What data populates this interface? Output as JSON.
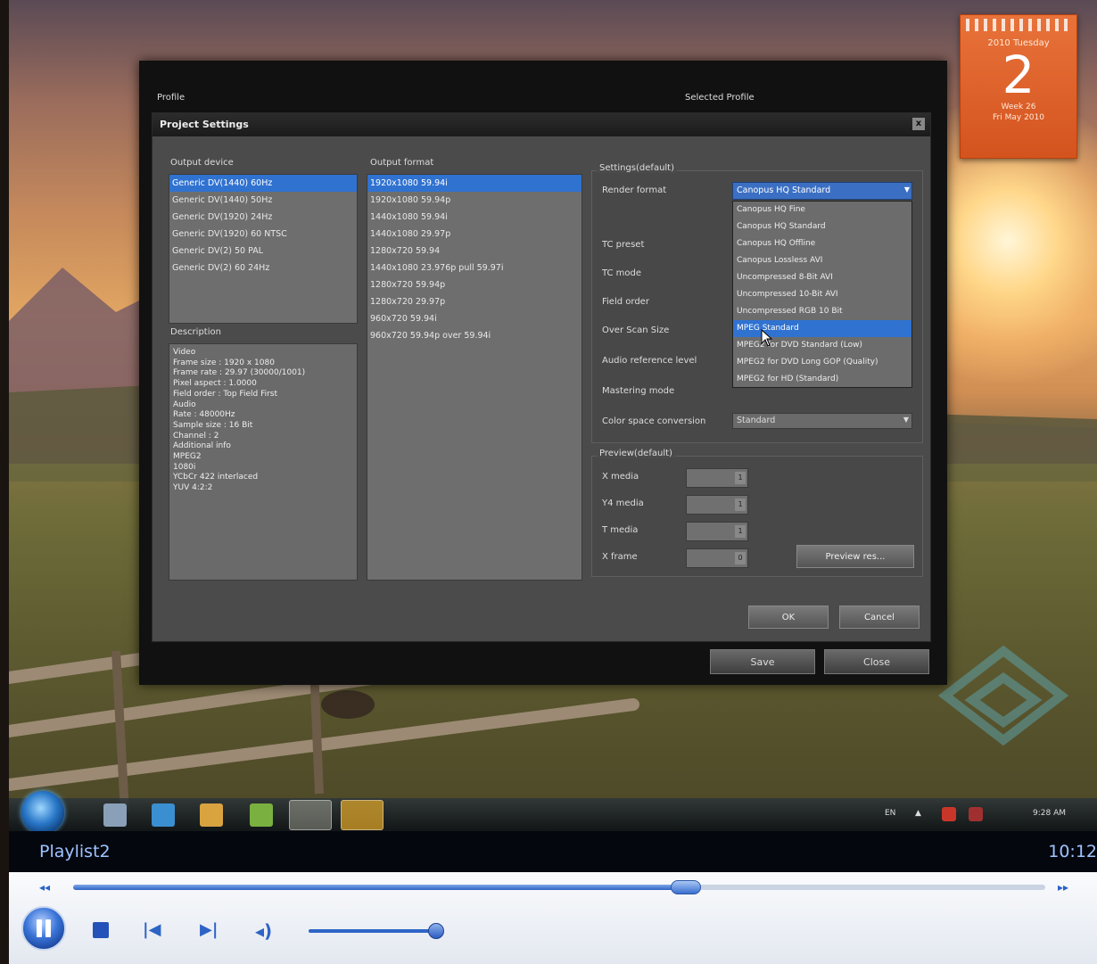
{
  "gadget": {
    "month": "2010 Tuesday",
    "day": "2",
    "week_a": "Week 26",
    "week_b": "Fri May 2010"
  },
  "outer_window": {
    "title_left": "Profile",
    "title_right": "Selected Profile",
    "save_label": "Save",
    "close_label": "Close"
  },
  "dialog": {
    "title": "Project Settings",
    "close_glyph": "x",
    "output_device_label": "Output device",
    "output_devices": [
      {
        "label": "Generic DV(1440) 60Hz",
        "selected": true
      },
      {
        "label": "Generic DV(1440) 50Hz",
        "selected": false
      },
      {
        "label": "Generic DV(1920) 24Hz",
        "selected": false
      },
      {
        "label": "Generic DV(1920) 60 NTSC",
        "selected": false
      },
      {
        "label": "Generic DV(2) 50 PAL",
        "selected": false
      },
      {
        "label": "Generic DV(2) 60 24Hz",
        "selected": false
      }
    ],
    "output_format_label": "Output format",
    "output_formats": [
      {
        "label": "1920x1080 59.94i",
        "selected": true
      },
      {
        "label": "1920x1080 59.94p",
        "selected": false
      },
      {
        "label": "1440x1080 59.94i",
        "selected": false
      },
      {
        "label": "1440x1080 29.97p",
        "selected": false
      },
      {
        "label": "1280x720 59.94",
        "selected": false
      },
      {
        "label": "1440x1080 23.976p pull 59.97i",
        "selected": false
      },
      {
        "label": "1280x720 59.94p",
        "selected": false
      },
      {
        "label": "1280x720 29.97p",
        "selected": false
      },
      {
        "label": "960x720 59.94i",
        "selected": false
      },
      {
        "label": "960x720 59.94p over 59.94i",
        "selected": false
      }
    ],
    "description_label": "Description",
    "description_lines": [
      "Video",
      "Frame size : 1920 x 1080",
      "Frame rate : 29.97 (30000/1001)",
      "Pixel aspect : 1.0000",
      "Field order : Top Field First",
      "Audio",
      "Rate : 48000Hz",
      "Sample size : 16 Bit",
      "Channel : 2",
      "Additional info",
      "MPEG2",
      "1080i",
      "YCbCr 422 interlaced",
      "YUV 4:2:2"
    ],
    "settings_group_label": "Settings(default)",
    "render_format_label": "Render format",
    "render_format_value": "Canopus HQ Standard",
    "render_format_options": [
      {
        "label": "Canopus HQ Fine",
        "selected": false
      },
      {
        "label": "Canopus HQ Standard",
        "selected": false
      },
      {
        "label": "Canopus HQ Offline",
        "selected": false
      },
      {
        "label": "Canopus Lossless AVI",
        "selected": false
      },
      {
        "label": "Uncompressed 8-Bit AVI",
        "selected": false
      },
      {
        "label": "Uncompressed 10-Bit AVI",
        "selected": false
      },
      {
        "label": "Uncompressed RGB 10 Bit",
        "selected": false
      },
      {
        "label": "MPEG Standard",
        "selected": true
      },
      {
        "label": "MPEG2 for DVD Standard (Low)",
        "selected": false
      },
      {
        "label": "MPEG2 for DVD Long GOP (Quality)",
        "selected": false
      },
      {
        "label": "MPEG2 for HD (Standard)",
        "selected": false
      }
    ],
    "row_labels": [
      "TC preset",
      "TC mode",
      "Field order",
      "Over Scan Size",
      "Audio reference level",
      "Mastering mode",
      "Color space conversion"
    ],
    "color_space_value": "Standard",
    "preview_group_label": "Preview(default)",
    "preview_rows": [
      {
        "label": "X media",
        "value": "1"
      },
      {
        "label": "Y4 media",
        "value": "1"
      },
      {
        "label": "T media",
        "value": "1"
      },
      {
        "label": "X frame",
        "value": "0"
      }
    ],
    "preview_btn": "Preview res...",
    "ok_label": "OK",
    "cancel_label": "Cancel"
  },
  "taskbar": {
    "clock": "9:28 AM",
    "tray_a": "EN",
    "tray_b": "▲"
  },
  "player": {
    "playlist_title": "Playlist2",
    "time": "10:12",
    "seek_progress": 0.63,
    "volume_level": 0.95,
    "rewind_glyph": "◂◂",
    "ff_glyph": "▸▸",
    "prev_glyph": "|◀",
    "next_glyph": "▶|",
    "volume_glyph": "◂)"
  }
}
